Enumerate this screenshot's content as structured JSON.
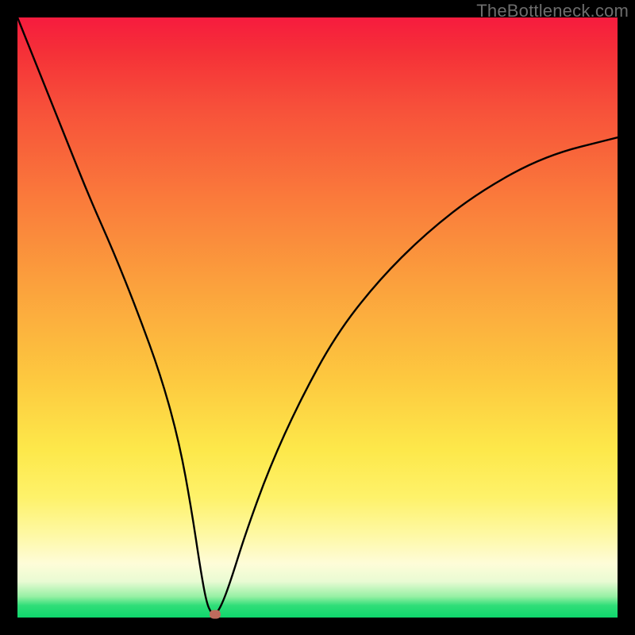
{
  "watermark": "TheBottleneck.com",
  "colors": {
    "frame": "#000000",
    "curve": "#000000",
    "marker": "#bf6b5d",
    "gradient_top": "#f61b3e",
    "gradient_bottom": "#0fd66c"
  },
  "chart_data": {
    "type": "line",
    "title": "",
    "xlabel": "",
    "ylabel": "",
    "xlim": [
      0,
      100
    ],
    "ylim": [
      0,
      100
    ],
    "series": [
      {
        "name": "bottleneck-curve",
        "x": [
          0,
          4,
          8,
          12,
          16,
          20,
          24,
          27,
          29,
          30.5,
          31.5,
          32.3,
          33,
          34,
          35.5,
          38,
          42,
          47,
          53,
          60,
          68,
          77,
          88,
          100
        ],
        "y": [
          100,
          90,
          80,
          70,
          61,
          51,
          40,
          29,
          18,
          8,
          2.5,
          0.7,
          0.5,
          2,
          6,
          14,
          25,
          36,
          47,
          56,
          64,
          71,
          77,
          80
        ]
      }
    ],
    "marker": {
      "x": 33,
      "y": 0.5
    },
    "grid": false,
    "legend": false
  }
}
